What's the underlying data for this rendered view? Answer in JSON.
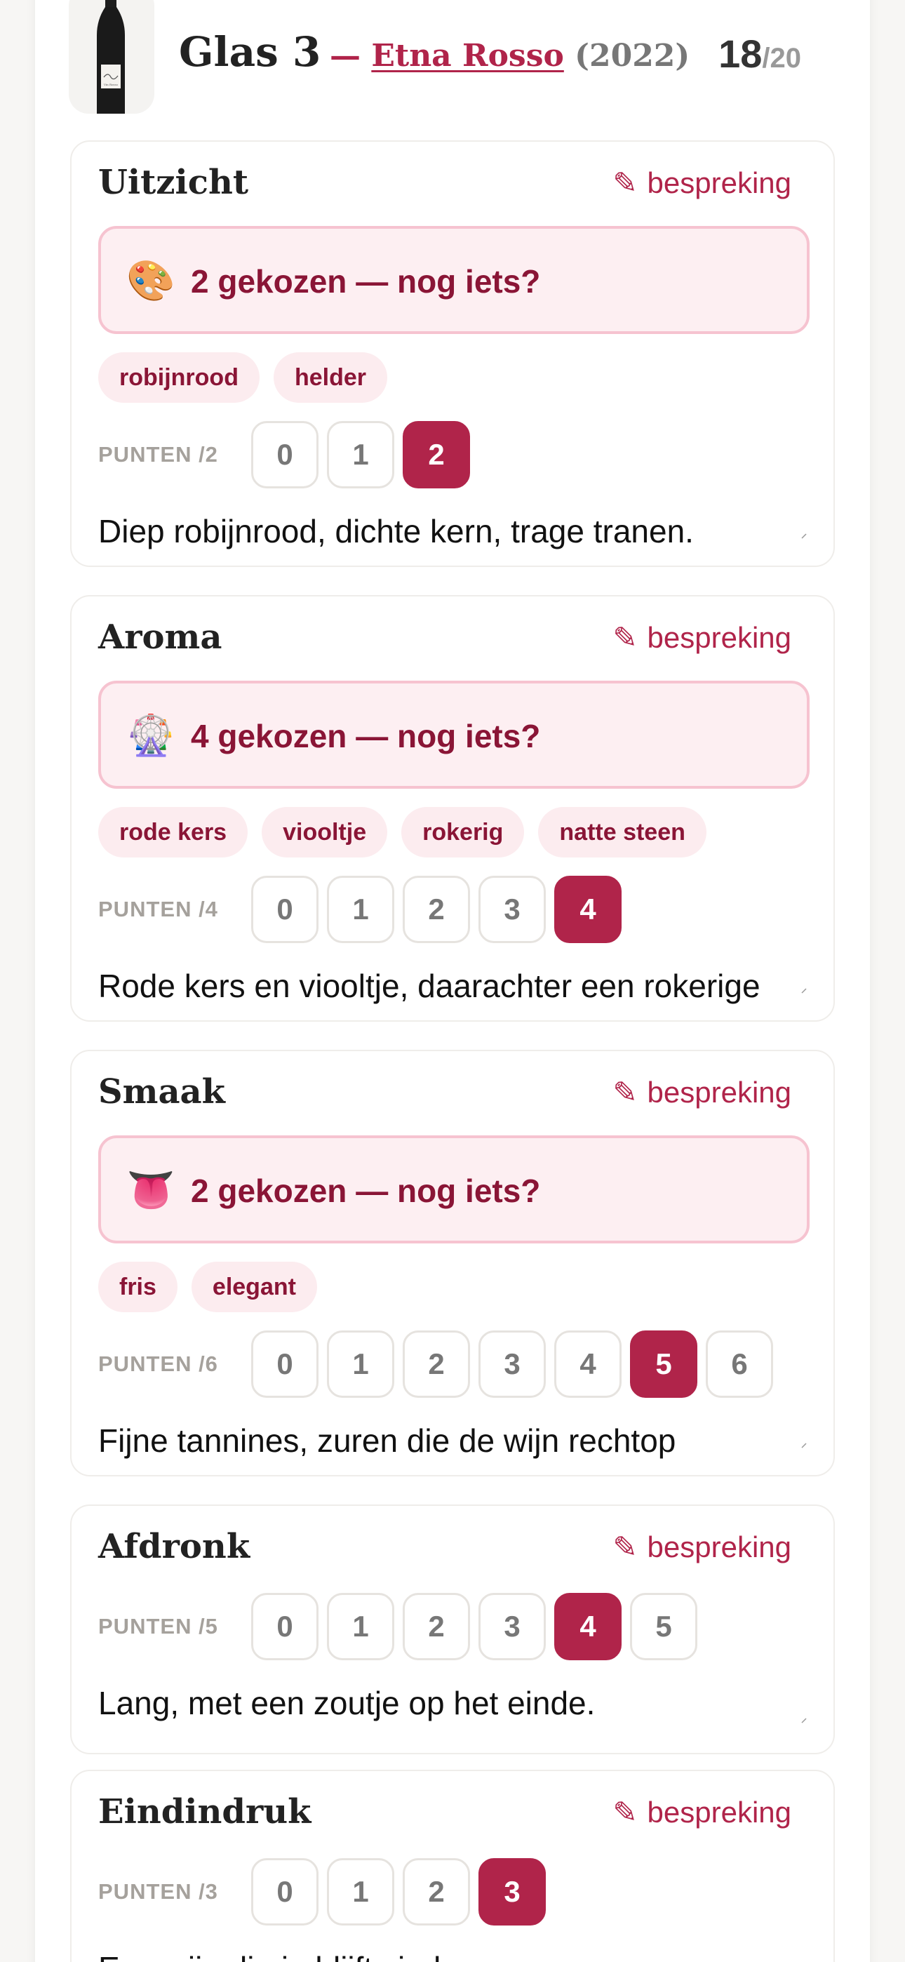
{
  "header": {
    "glass_title": "Glas 3",
    "dash": "—",
    "wine_name": "Etna Rosso",
    "wine_year": "(2022)",
    "total_score": "18",
    "total_max": "/20",
    "bottle_label_text": "Vin Rosso"
  },
  "common": {
    "discuss_label": "bespreking",
    "pencil_glyph": "✎"
  },
  "colors": {
    "accent": "#b0244a",
    "accent_dark": "#8a1536",
    "picker_bg": "#fdeff2",
    "picker_border": "#f6c3d0",
    "chip_bg": "#fcecef"
  },
  "sections": [
    {
      "title": "Uitzicht",
      "picker_icon": "palette-icon",
      "picker_emoji": "🎨",
      "picker_text": "2 gekozen — nog iets?",
      "chips": [
        "robijnrood",
        "helder"
      ],
      "score_label": "PUNTEN /2",
      "score_options": [
        "0",
        "1",
        "2"
      ],
      "score_selected": "2",
      "note": "Diep robijnrood, dichte kern, trage tranen."
    },
    {
      "title": "Aroma",
      "picker_icon": "ferris-wheel-icon",
      "picker_emoji": "🎡",
      "picker_text": "4 gekozen — nog iets?",
      "chips": [
        "rode kers",
        "viooltje",
        "rokerig",
        "natte steen"
      ],
      "score_label": "PUNTEN /4",
      "score_options": [
        "0",
        "1",
        "2",
        "3",
        "4"
      ],
      "score_selected": "4",
      "note": "Rode kers en viooltje, daarachter een rokerige"
    },
    {
      "title": "Smaak",
      "picker_icon": "tongue-icon",
      "picker_emoji": "👅",
      "picker_text": "2 gekozen — nog iets?",
      "chips": [
        "fris",
        "elegant"
      ],
      "score_label": "PUNTEN /6",
      "score_options": [
        "0",
        "1",
        "2",
        "3",
        "4",
        "5",
        "6"
      ],
      "score_selected": "5",
      "note": "Fijne tannines, zuren die de wijn rechtop"
    },
    {
      "title": "Afdronk",
      "score_label": "PUNTEN /5",
      "score_options": [
        "0",
        "1",
        "2",
        "3",
        "4",
        "5"
      ],
      "score_selected": "4",
      "note": "Lang, met een zoutje op het einde."
    },
    {
      "title": "Eindindruk",
      "score_label": "PUNTEN /3",
      "score_options": [
        "0",
        "1",
        "2",
        "3"
      ],
      "score_selected": "3",
      "note": "Een wijn die je blijft vinden."
    }
  ]
}
